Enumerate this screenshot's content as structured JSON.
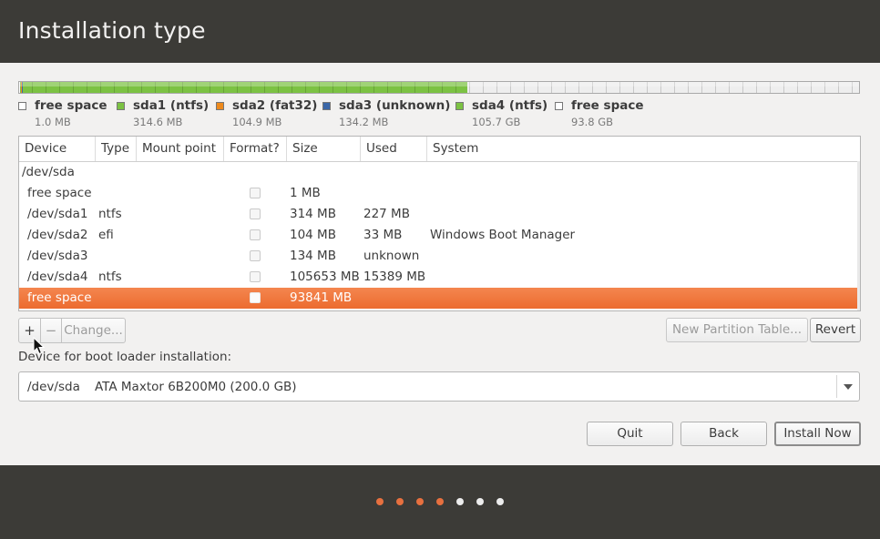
{
  "page": {
    "title": "Installation type"
  },
  "colors": {
    "free": "#ffffff",
    "sda1": "#7cc243",
    "sda2": "#ee8a1c",
    "sda3": "#3b67a8",
    "sda4": "#7cc243",
    "selected_row": "#ef743b",
    "dot_active": "#e7703f",
    "dot_inactive": "#ececec"
  },
  "partition_bar": {
    "segments": [
      {
        "name": "free space",
        "fraction": 1e-05,
        "color": "#ffffff"
      },
      {
        "name": "sda1 (ntfs)",
        "fraction": 0.0016,
        "color": "#7cc243"
      },
      {
        "name": "sda2 (fat32)",
        "fraction": 0.0005,
        "color": "#ee8a1c"
      },
      {
        "name": "sda3 (unknown)",
        "fraction": 0.0007,
        "color": "#3b67a8"
      },
      {
        "name": "sda4 (ntfs)",
        "fraction": 0.5295,
        "color": "#7cc243"
      },
      {
        "name": "free space",
        "fraction": 0.4677,
        "color": "#eeeeee"
      }
    ]
  },
  "legend": [
    {
      "name": "free space",
      "size": "1.0 MB",
      "color": "#ffffff"
    },
    {
      "name": "sda1 (ntfs)",
      "size": "314.6 MB",
      "color": "#7cc243"
    },
    {
      "name": "sda2 (fat32)",
      "size": "104.9 MB",
      "color": "#ee8a1c"
    },
    {
      "name": "sda3 (unknown)",
      "size": "134.2 MB",
      "color": "#3b67a8"
    },
    {
      "name": "sda4 (ntfs)",
      "size": "105.7 GB",
      "color": "#7cc243"
    },
    {
      "name": "free space",
      "size": "93.8 GB",
      "color": "#ffffff"
    }
  ],
  "table": {
    "columns": [
      "Device",
      "Type",
      "Mount point",
      "Format?",
      "Size",
      "Used",
      "System"
    ],
    "rows": [
      {
        "device": "/dev/sda",
        "type": "",
        "mount": "",
        "format": false,
        "size": "",
        "used": "",
        "system": "",
        "heading": true
      },
      {
        "device": "free space",
        "type": "",
        "mount": "",
        "format": false,
        "size": "1 MB",
        "used": "",
        "system": ""
      },
      {
        "device": "/dev/sda1",
        "type": "ntfs",
        "mount": "",
        "format": false,
        "size": "314 MB",
        "used": "227 MB",
        "system": ""
      },
      {
        "device": "/dev/sda2",
        "type": "efi",
        "mount": "",
        "format": false,
        "size": "104 MB",
        "used": "33 MB",
        "system": "Windows Boot Manager"
      },
      {
        "device": "/dev/sda3",
        "type": "",
        "mount": "",
        "format": false,
        "size": "134 MB",
        "used": "unknown",
        "system": ""
      },
      {
        "device": "/dev/sda4",
        "type": "ntfs",
        "mount": "",
        "format": false,
        "size": "105653 MB",
        "used": "15389 MB",
        "system": ""
      },
      {
        "device": "free space",
        "type": "",
        "mount": "",
        "format": false,
        "size": "93841 MB",
        "used": "",
        "system": "",
        "selected": true
      }
    ]
  },
  "toolbar": {
    "add_label": "+",
    "remove_label": "−",
    "change_label": "Change..."
  },
  "partition_buttons": {
    "new_table_label": "New Partition Table...",
    "revert_label": "Revert"
  },
  "boot_loader": {
    "label": "Device for boot loader installation:",
    "device": "/dev/sda",
    "description": "ATA Maxtor 6B200M0 (200.0 GB)"
  },
  "actions": {
    "quit_label": "Quit",
    "back_label": "Back",
    "install_label": "Install Now"
  },
  "progress": {
    "total_steps": 7,
    "completed_steps": 4
  }
}
